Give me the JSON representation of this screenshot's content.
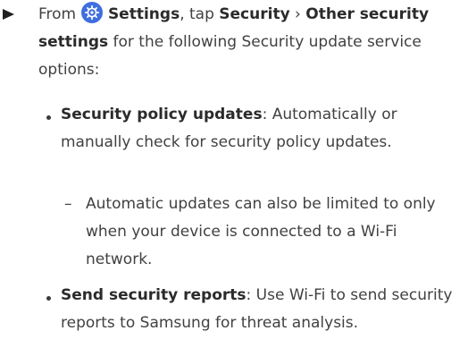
{
  "step": {
    "prefix": "From ",
    "settings": "Settings",
    "tap": ", tap ",
    "security": "Security",
    "separator": " › ",
    "other_security": "Other security settings",
    "suffix": " for the following Security update service options:",
    "icon": "settings-gear-icon",
    "icon_color": "#3f6ee0"
  },
  "bullets": [
    {
      "title": "Security policy updates",
      "body": ": Automatically or manually check for security policy updates."
    },
    {
      "title": "Send security reports",
      "body": ": Use Wi-Fi to send security reports to Samsung for threat analysis."
    }
  ],
  "sub_bullets": [
    {
      "dash": "–",
      "text": "Automatic updates can also be limited to only when your device is connected to a Wi-Fi network."
    }
  ]
}
